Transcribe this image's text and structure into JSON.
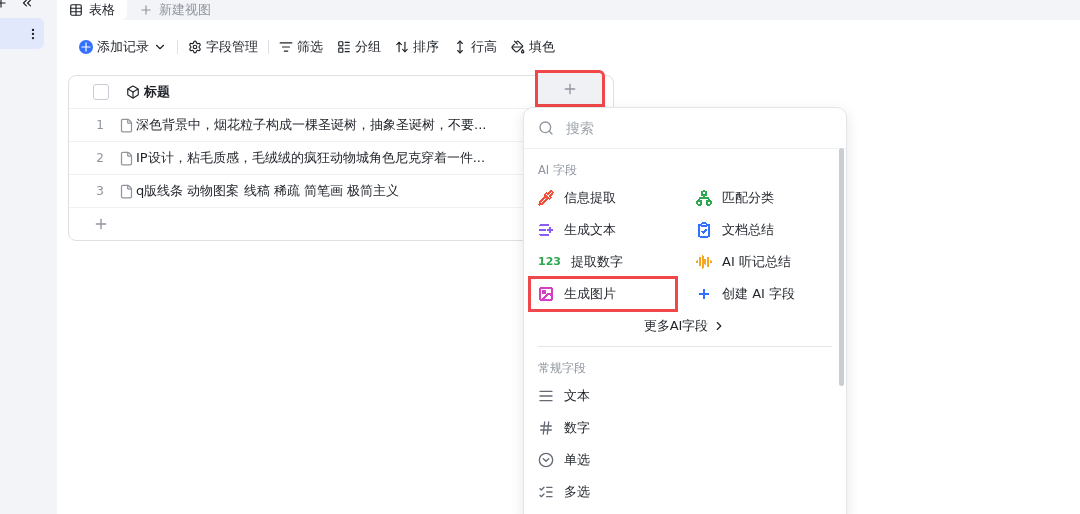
{
  "sidebar": {
    "items": [
      {
        "selected": true
      }
    ]
  },
  "view_tabs": [
    {
      "label": "表格",
      "selected": true
    },
    {
      "label": "新建视图",
      "selected": false
    }
  ],
  "toolbar": [
    "添加记录",
    "字段管理",
    "筛选",
    "分组",
    "排序",
    "行高",
    "填色"
  ],
  "table": {
    "checked": false,
    "column": "标题",
    "add_column": {
      "annotated": true
    },
    "rows": [
      {
        "index": "1",
        "title": "深色背景中，烟花粒子构成一棵圣诞树，抽象圣诞树，不要..."
      },
      {
        "index": "2",
        "title": "IP设计，粘毛质感，毛绒绒的疯狂动物城角色尼克穿着一件..."
      },
      {
        "index": "3",
        "title": "q版线条 动物图案 线稿 稀疏 简笔画 极简主义"
      }
    ]
  },
  "menu": {
    "placeholder": "搜索",
    "ai_section": "AI 字段",
    "ai_items": [
      {
        "label": "信息提取",
        "color": "#f0503c",
        "annotated": false
      },
      {
        "label": "匹配分类",
        "color": "#2fa84f",
        "annotated": false
      },
      {
        "label": "生成文本",
        "color": "#8a5cf0",
        "annotated": false
      },
      {
        "label": "文档总结",
        "color": "#3370ff",
        "annotated": false
      },
      {
        "label": "提取数字",
        "color": "#2fa84f",
        "badge": "123",
        "annotated": false
      },
      {
        "label": "AI 听记总结",
        "color": "#f5a623",
        "annotated": false
      },
      {
        "label": "生成图片",
        "color": "#d63fc5",
        "annotated": true
      },
      {
        "label": "创建 AI 字段",
        "color": "#3370ff",
        "annotated": false
      }
    ],
    "more": "更多AI字段",
    "regular_section": "常规字段",
    "regular_items": [
      "文本",
      "数字",
      "单选",
      "多选"
    ]
  }
}
